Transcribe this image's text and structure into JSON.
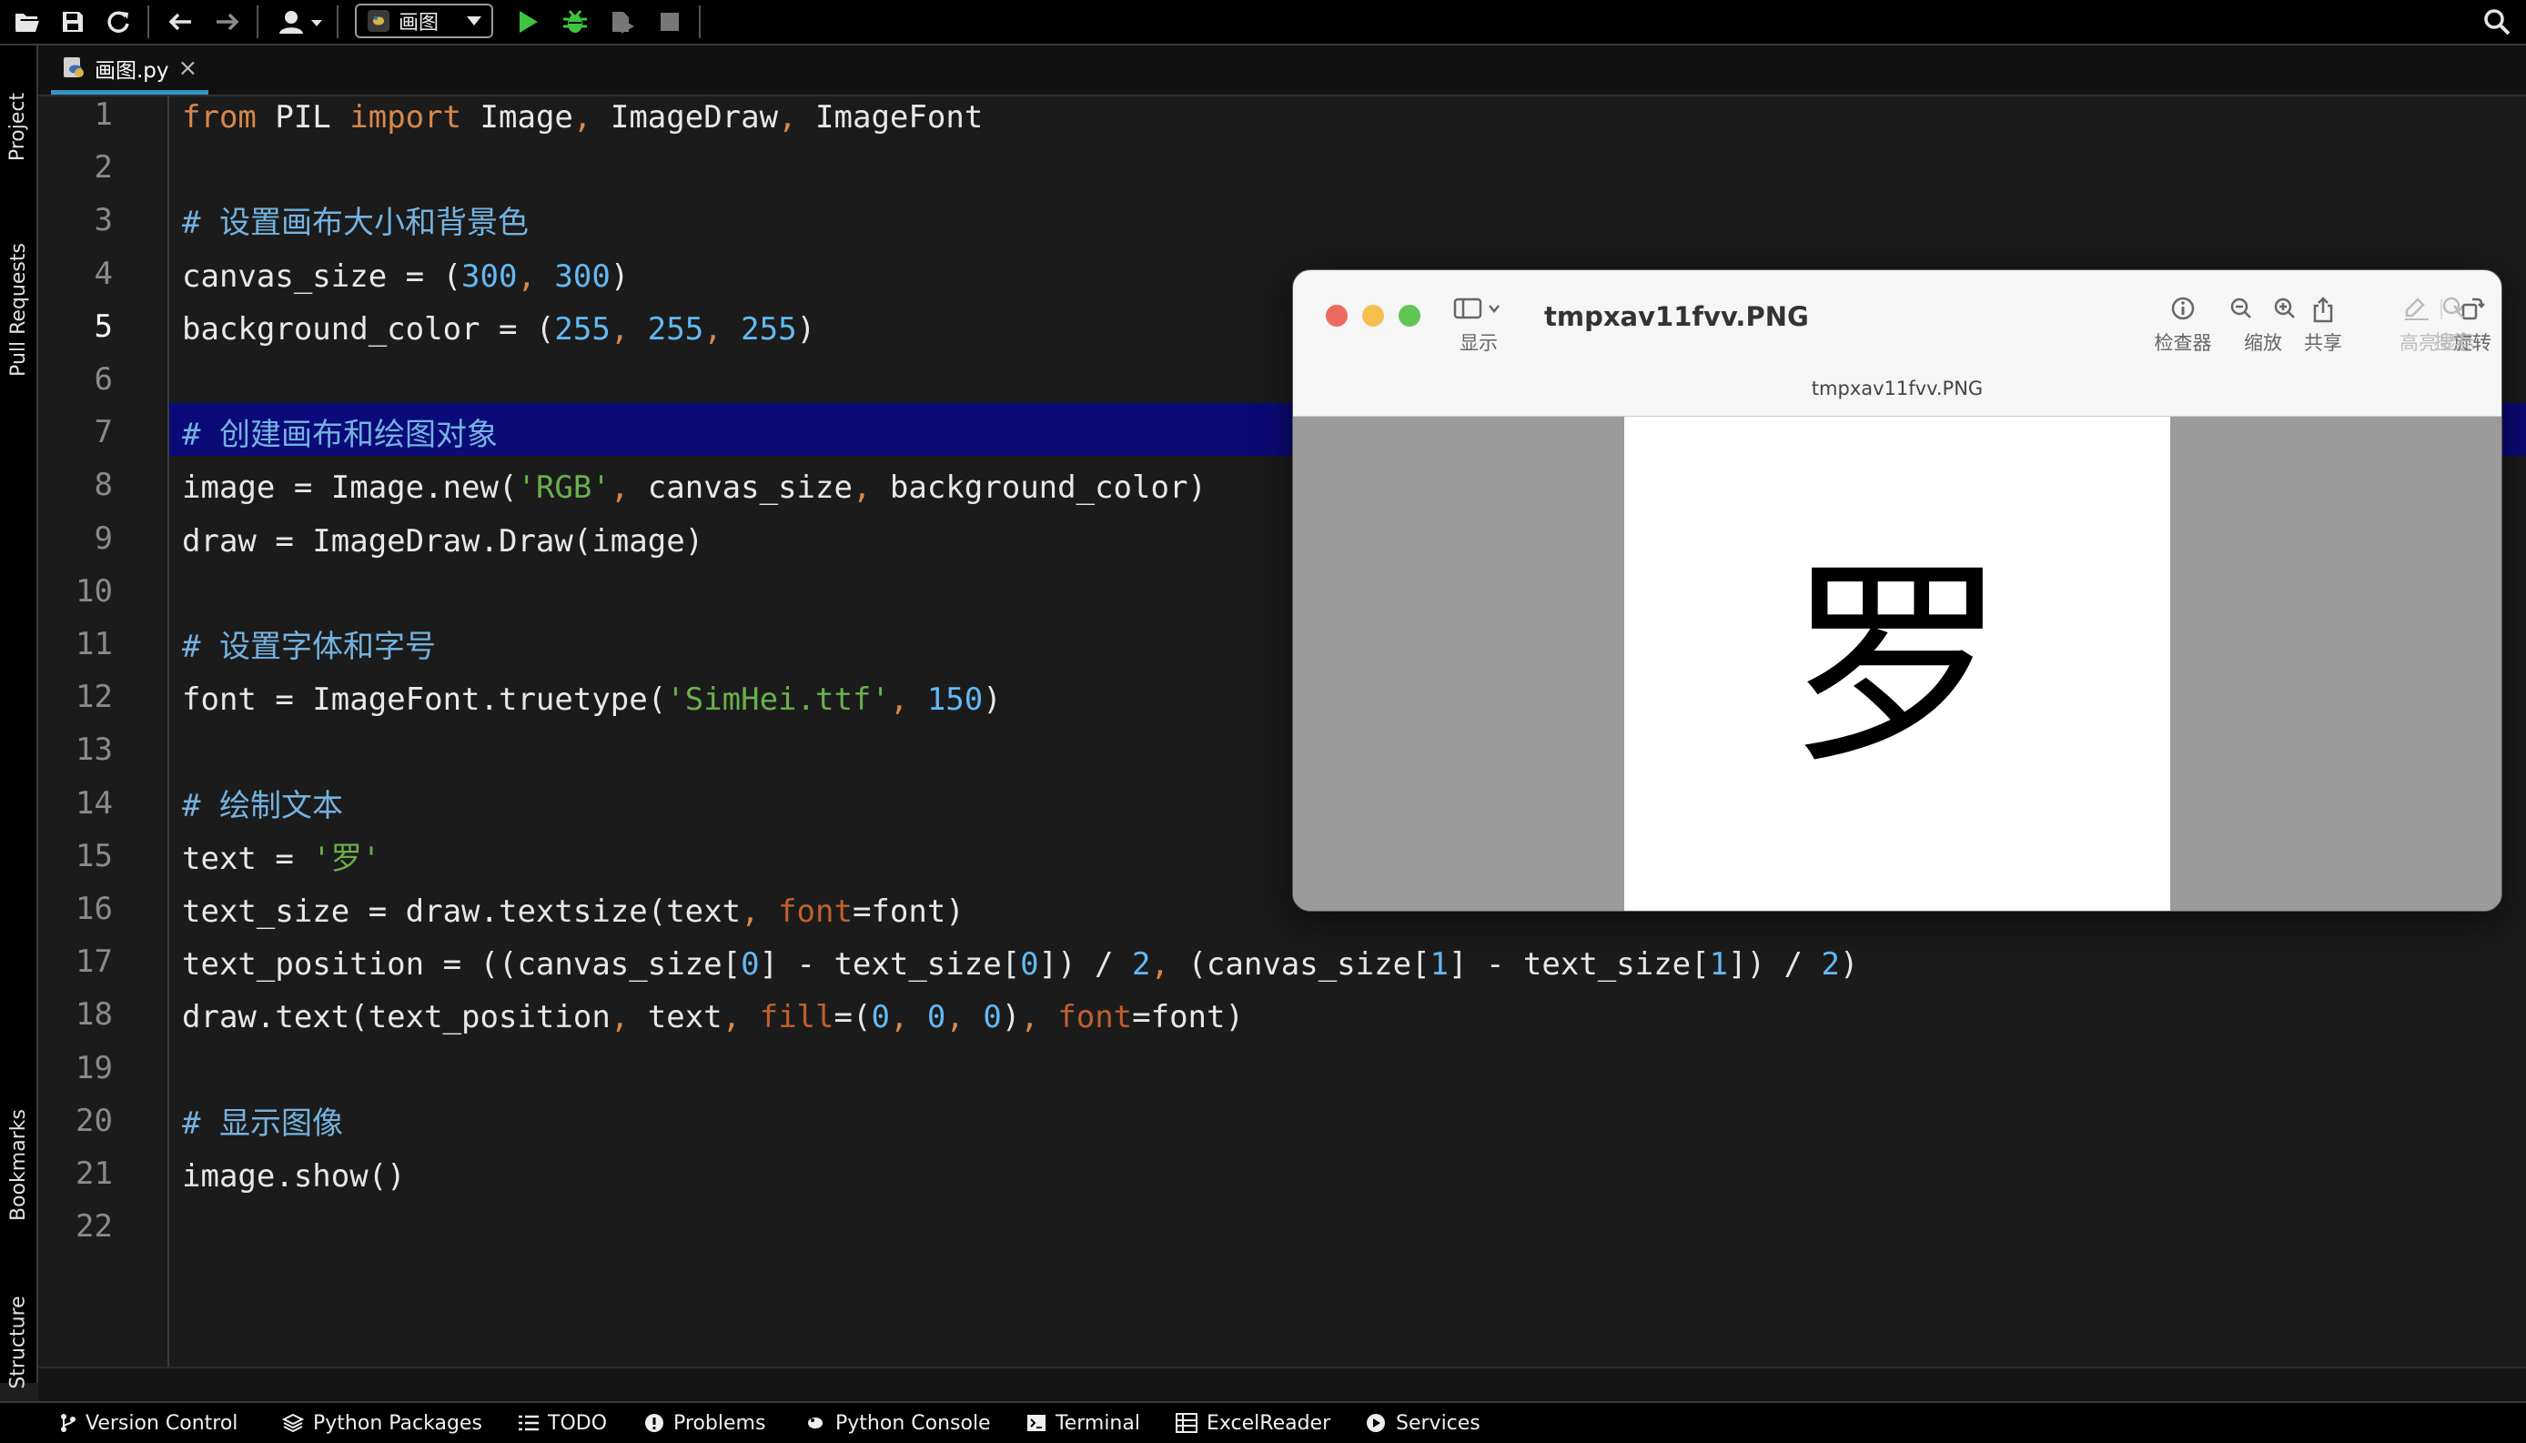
{
  "toolbar": {
    "run_config_label": "画图"
  },
  "left_rail": {
    "project": "Project",
    "pull_requests": "Pull Requests",
    "bookmarks": "Bookmarks",
    "structure": "Structure"
  },
  "editor_tab": {
    "file_name": "画图.py",
    "close": "×"
  },
  "editor": {
    "line_numbers": [
      "1",
      "2",
      "3",
      "4",
      "5",
      "6",
      "7",
      "8",
      "9",
      "10",
      "11",
      "12",
      "13",
      "14",
      "15",
      "16",
      "17",
      "18",
      "19",
      "20",
      "21",
      "22"
    ],
    "active_line": "5",
    "code": {
      "l1": {
        "p1": "from",
        "p2": " PIL ",
        "p3": "import",
        "p4": " Image",
        ",1": ",",
        "p5": " ImageDraw",
        ",2": ",",
        "p6": " ImageFont"
      },
      "l3": "# 设置画布大小和背景色",
      "l4": {
        "a": "canvas_size = (",
        "n1": "300",
        ",": ", ",
        "n2": "300",
        "b": ")"
      },
      "l5": {
        "a": "background_color = (",
        "n1": "255",
        "c1": ", ",
        "n2": "255",
        "c2": ", ",
        "n3": "255",
        "b": ")"
      },
      "l7": "# 创建画布和绘图对象",
      "l8": {
        "a": "image = Image.new(",
        "s": "'RGB'",
        "c1": ", ",
        "b": "canvas_size",
        "c2": ", ",
        "c": "background_color)"
      },
      "l9": "draw = ImageDraw.Draw(image)",
      "l11": "# 设置字体和字号",
      "l12": {
        "a": "font = ImageFont.truetype(",
        "s": "'SimHei.ttf'",
        "c": ", ",
        "n": "150",
        "b": ")"
      },
      "l14": "# 绘制文本",
      "l15": {
        "a": "text = ",
        "s": "'罗'"
      },
      "l16": {
        "a": "text_size = draw.textsize(text",
        "c": ", ",
        "k": "font",
        "b": "=font)"
      },
      "l17": {
        "a": "text_position = ((canvas_size[",
        "n1": "0",
        "b": "] - text_size[",
        "n2": "0",
        "c": "]) / ",
        "n3": "2",
        "c2": ", ",
        "d": "(canvas_size[",
        "n4": "1",
        "e": "] - text_size[",
        "n5": "1",
        "f": "]) / ",
        "n6": "2",
        "g": ")"
      },
      "l18": {
        "a": "draw.text(text_position",
        "c1": ", ",
        "b": "text",
        "c2": ", ",
        "k1": "fill",
        "c": "=(",
        "n1": "0",
        "c3": ", ",
        "n2": "0",
        "c4": ", ",
        "n3": "0",
        "d": ")",
        "c5": ", ",
        "k2": "font",
        "e": "=font)"
      },
      "l20": "# 显示图像",
      "l21": "image.show()"
    }
  },
  "preview": {
    "title": "tmpxav11fvv.PNG",
    "subtitle": "tmpxav11fvv.PNG",
    "tools": {
      "sidebar": "显示",
      "inspector": "检查器",
      "zoom": "缩放",
      "share": "共享",
      "highlight": "高亮显示",
      "rotate": "旋转",
      "markup": "标记",
      "search": "搜索"
    },
    "image_character": "罗"
  },
  "status_bar": {
    "version_control": "Version Control",
    "python_packages": "Python Packages",
    "todo": "TODO",
    "problems": "Problems",
    "python_console": "Python Console",
    "terminal": "Terminal",
    "excel_reader": "ExcelReader",
    "services": "Services"
  },
  "colors": {
    "keyword": "#d8874a",
    "number": "#63b9f3",
    "string": "#6ab04c",
    "comment": "#74b3e0",
    "current_line": "#0a0a78",
    "run_green": "#3ec43e"
  }
}
